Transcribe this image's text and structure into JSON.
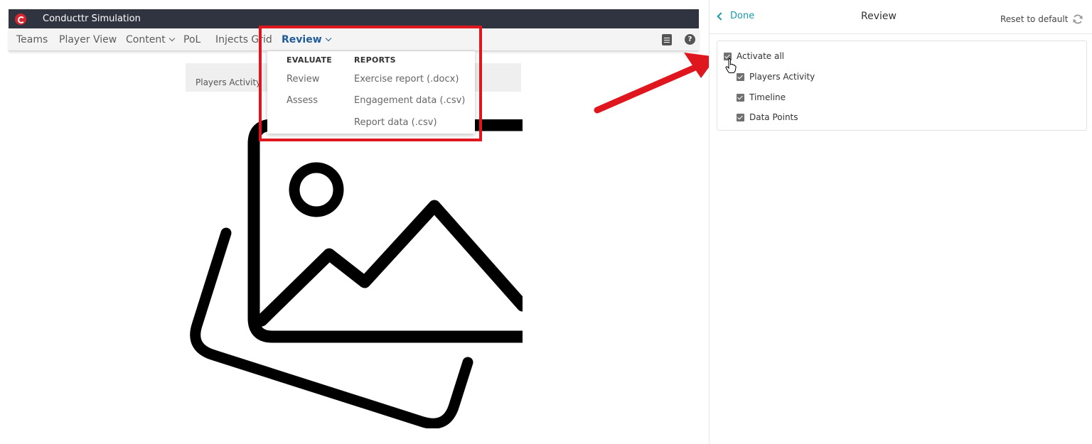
{
  "app": {
    "title": "Conducttr Simulation"
  },
  "nav": {
    "items": [
      {
        "label": "Teams",
        "dropdown": false,
        "active": false
      },
      {
        "label": "Player View",
        "dropdown": false,
        "active": false
      },
      {
        "label": "Content",
        "dropdown": true,
        "active": false
      },
      {
        "label": "PoL",
        "dropdown": false,
        "active": false
      },
      {
        "label": "Injects Grid",
        "dropdown": false,
        "active": false
      },
      {
        "label": "Review",
        "dropdown": true,
        "active": true
      }
    ]
  },
  "content": {
    "tab_label": "Players Activity"
  },
  "review_menu": {
    "evaluate_heading": "EVALUATE",
    "reports_heading": "REPORTS",
    "evaluate_items": [
      "Review",
      "Assess"
    ],
    "report_items": [
      "Exercise report (.docx)",
      "Engagement data (.csv)",
      "Report data (.csv)"
    ]
  },
  "panel": {
    "done_label": "Done",
    "title": "Review",
    "reset_label": "Reset to default",
    "options": [
      {
        "label": "Activate all",
        "checked": true,
        "level": 0
      },
      {
        "label": "Players Activity",
        "checked": true,
        "level": 1
      },
      {
        "label": "Timeline",
        "checked": true,
        "level": 1
      },
      {
        "label": "Data Points",
        "checked": true,
        "level": 1
      }
    ]
  },
  "colors": {
    "titlebar": "#2f3440",
    "nav_active": "#1f5c99",
    "highlight": "#e0161f",
    "accent": "#1a9aa8",
    "checkbox": "#707070"
  },
  "icons": [
    "logo-icon",
    "document-icon",
    "help-icon",
    "image-placeholder-icon",
    "back-chevron-icon",
    "refresh-icon",
    "hand-cursor-icon",
    "annotation-arrow"
  ]
}
